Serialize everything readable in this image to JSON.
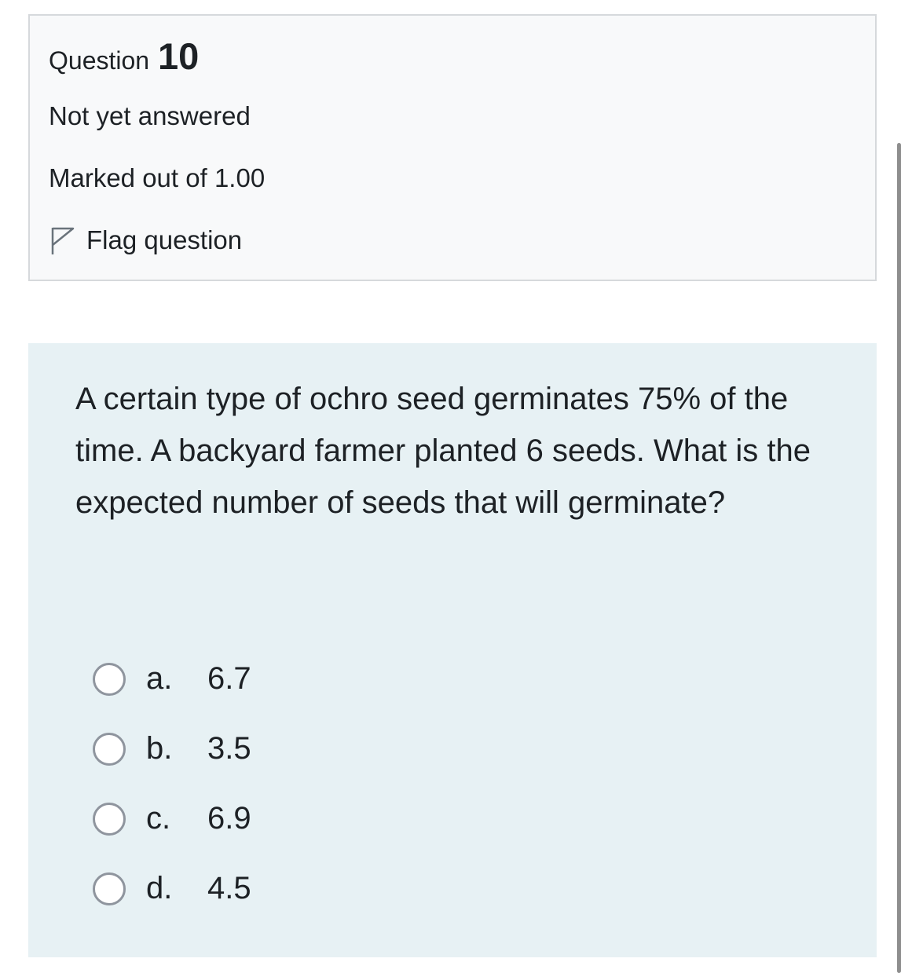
{
  "info": {
    "question_label": "Question",
    "question_number": "10",
    "state": "Not yet answered",
    "grade": "Marked out of 1.00",
    "flag_label": "Flag question",
    "flag_icon": "flag-outline-icon"
  },
  "question": {
    "text": "A certain type of ochro seed germinates 75% of the time. A backyard farmer planted 6 seeds. What is the expected number of seeds that will germinate?",
    "options": [
      {
        "letter": "a.",
        "text": "6.7",
        "selected": false
      },
      {
        "letter": "b.",
        "text": "3.5",
        "selected": false
      },
      {
        "letter": "c.",
        "text": "6.9",
        "selected": false
      },
      {
        "letter": "d.",
        "text": "4.5",
        "selected": false
      }
    ]
  },
  "colors": {
    "info_bg": "#f8f9fa",
    "info_border": "#d6d9dc",
    "formulation_bg": "#e7f1f4",
    "radio_border": "#8f959e",
    "text": "#1d2125"
  }
}
